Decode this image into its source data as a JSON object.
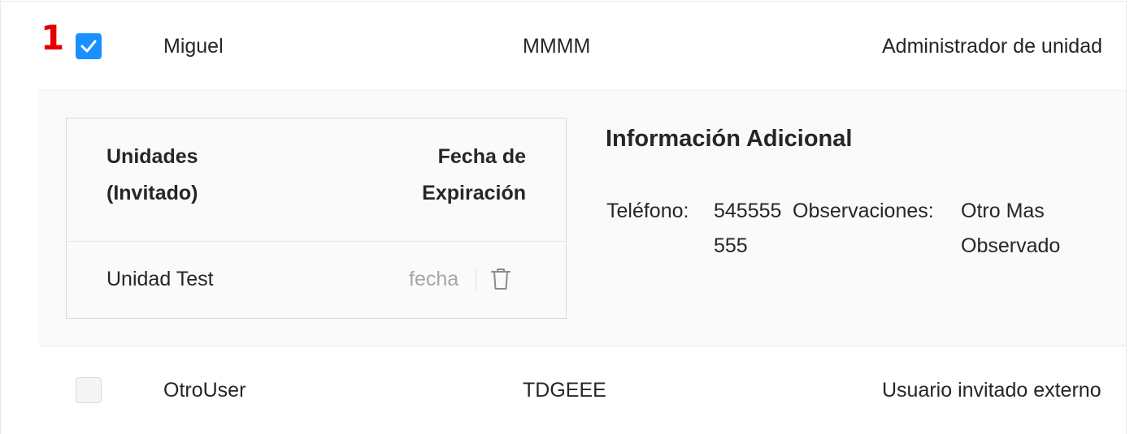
{
  "rows": [
    {
      "index_badge": "1",
      "checked": true,
      "name": "Miguel",
      "code": "MMMM",
      "role": "Administrador de unidad"
    },
    {
      "checked": false,
      "name": "OtroUser",
      "code": "TDGEEE",
      "role": "Usuario invitado externo"
    }
  ],
  "expanded": {
    "table": {
      "col_unit": [
        "Unidades",
        "(Invitado)"
      ],
      "col_expiration": [
        "Fecha de",
        "Expiración"
      ],
      "rows": [
        {
          "unit": "Unidad Test",
          "date": "fecha"
        }
      ]
    },
    "info": {
      "title": "Información Adicional",
      "phone_label": "Teléfono",
      "phone_value": [
        "545555",
        "555"
      ],
      "obs_label": "Observaciones",
      "obs_value": [
        "Otro Mas",
        "Observado"
      ],
      "separator": ":"
    }
  },
  "icons": {
    "checkbox_check": "check-icon",
    "delete": "trash-icon"
  },
  "colors": {
    "accent": "#1890ff",
    "badge": "#e60000",
    "muted": "#a6a6a6"
  }
}
